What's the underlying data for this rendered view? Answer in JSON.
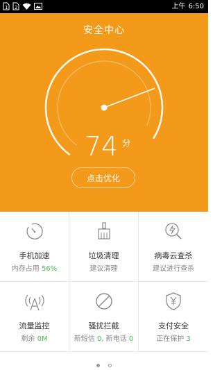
{
  "status_bar": {
    "sim1": "1",
    "sim2": "2",
    "time_prefix": "上午",
    "time": "6:50"
  },
  "header": {
    "title": "安全中心"
  },
  "gauge": {
    "score": "74",
    "unit": "分",
    "level": 74,
    "max": 100
  },
  "optimize_label": "点击优化",
  "features": [
    {
      "name": "手机加速",
      "sub_prefix": "内存占用 ",
      "sub_value": "56%",
      "icon": "speed-dial-icon"
    },
    {
      "name": "垃圾清理",
      "sub": "建议清理",
      "icon": "broom-icon"
    },
    {
      "name": "病毒云查杀",
      "sub": "建议进行查杀",
      "icon": "virus-scan-icon"
    },
    {
      "name": "流量监控",
      "sub_prefix": "剩余 ",
      "sub_value": "0M",
      "icon": "signal-tower-icon"
    },
    {
      "name": "骚扰拦截",
      "sub_a_prefix": "新短信 ",
      "sub_a_value": "0",
      "sub_b_prefix": ", 新电话 ",
      "sub_b_value": "0",
      "icon": "block-icon"
    },
    {
      "name": "支付安全",
      "sub_prefix": "正在保护 ",
      "sub_value": "3",
      "icon": "shield-yuan-icon"
    }
  ],
  "colors": {
    "accent": "#f39a1b",
    "positive": "#47c14a"
  },
  "pager": {
    "pages": 2,
    "current": 1
  }
}
